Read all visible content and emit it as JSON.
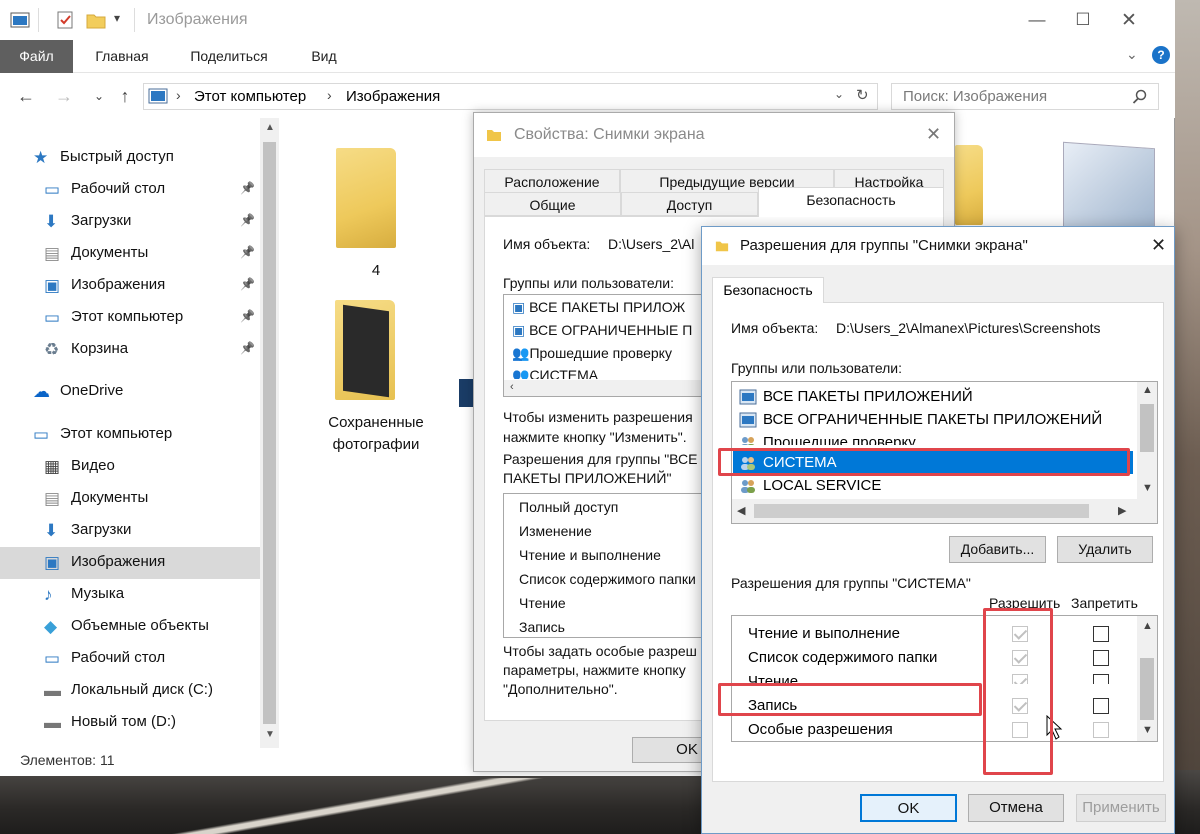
{
  "window": {
    "title": "Изображения",
    "minimize": "—",
    "maximize": "☐",
    "close": "✕"
  },
  "ribbon": {
    "tabs": [
      "Файл",
      "Главная",
      "Поделиться",
      "Вид"
    ],
    "help": "?"
  },
  "address": {
    "crumbs": [
      "Этот компьютер",
      "Изображения"
    ],
    "search_placeholder": "Поиск: Изображения"
  },
  "nav": {
    "items": [
      {
        "label": "Быстрый доступ",
        "icon": "star-icon",
        "pinned": false,
        "indent": 0
      },
      {
        "label": "Рабочий стол",
        "icon": "desktop-icon",
        "pinned": true,
        "indent": 1
      },
      {
        "label": "Загрузки",
        "icon": "download-icon",
        "pinned": true,
        "indent": 1
      },
      {
        "label": "Документы",
        "icon": "document-icon",
        "pinned": true,
        "indent": 1
      },
      {
        "label": "Изображения",
        "icon": "pictures-icon",
        "pinned": true,
        "indent": 1
      },
      {
        "label": "Этот компьютер",
        "icon": "computer-icon",
        "pinned": true,
        "indent": 1
      },
      {
        "label": "Корзина",
        "icon": "recycle-bin-icon",
        "pinned": true,
        "indent": 1
      },
      {
        "label": "OneDrive",
        "icon": "onedrive-icon",
        "pinned": false,
        "indent": 0
      },
      {
        "label": "Этот компьютер",
        "icon": "computer-icon",
        "pinned": false,
        "indent": 0
      },
      {
        "label": "Видео",
        "icon": "video-icon",
        "pinned": false,
        "indent": 1
      },
      {
        "label": "Документы",
        "icon": "document-icon",
        "pinned": false,
        "indent": 1
      },
      {
        "label": "Загрузки",
        "icon": "download-icon",
        "pinned": false,
        "indent": 1
      },
      {
        "label": "Изображения",
        "icon": "pictures-icon",
        "pinned": false,
        "indent": 1,
        "selected": true
      },
      {
        "label": "Музыка",
        "icon": "music-icon",
        "pinned": false,
        "indent": 1
      },
      {
        "label": "Объемные объекты",
        "icon": "3d-objects-icon",
        "pinned": false,
        "indent": 1
      },
      {
        "label": "Рабочий стол",
        "icon": "desktop-icon",
        "pinned": false,
        "indent": 1
      },
      {
        "label": "Локальный диск (C:)",
        "icon": "drive-icon",
        "pinned": false,
        "indent": 1
      },
      {
        "label": "Новый том (D:)",
        "icon": "drive-icon",
        "pinned": false,
        "indent": 1
      }
    ]
  },
  "status": {
    "items_count": "Элементов: 11"
  },
  "content": {
    "folders": [
      {
        "label": "4"
      },
      {
        "label1": "Сохраненные",
        "label2": "фотографии"
      }
    ]
  },
  "props_dialog": {
    "title": "Свойства: Снимки экрана",
    "tabs_row1": [
      "Расположение",
      "Предыдущие версии",
      "Настройка"
    ],
    "tabs_row2": [
      "Общие",
      "Доступ",
      "Безопасность"
    ],
    "object_label": "Имя объекта:",
    "object_value": "D:\\Users_2\\Al",
    "groups_label": "Группы или пользователи:",
    "groups": [
      "ВСЕ ПАКЕТЫ ПРИЛОЖ",
      "ВСЕ ОГРАНИЧЕННЫЕ П",
      "Прошедшие проверку",
      "СИСТЕМА"
    ],
    "change_hint1": "Чтобы изменить разрешения",
    "change_hint2": "нажмите кнопку \"Изменить\".",
    "perm_for1": "Разрешения для группы \"ВСЕ",
    "perm_for2": "ПАКЕТЫ ПРИЛОЖЕНИЙ\"",
    "perms": [
      "Полный доступ",
      "Изменение",
      "Чтение и выполнение",
      "Список содержимого папки",
      "Чтение",
      "Запись"
    ],
    "special_hint1": "Чтобы задать особые разреш",
    "special_hint2": "параметры, нажмите кнопку",
    "special_hint3": "\"Дополнительно\".",
    "ok": "OK"
  },
  "perm_dialog": {
    "title": "Разрешения для группы \"Снимки экрана\"",
    "tab": "Безопасность",
    "object_label": "Имя объекта:",
    "object_value": "D:\\Users_2\\Almanex\\Pictures\\Screenshots",
    "groups_label": "Группы или пользователи:",
    "groups": [
      {
        "label": "ВСЕ ПАКЕТЫ ПРИЛОЖЕНИЙ",
        "icon": "app-package-icon"
      },
      {
        "label": "ВСЕ ОГРАНИЧЕННЫЕ ПАКЕТЫ ПРИЛОЖЕНИЙ",
        "icon": "app-package-icon"
      },
      {
        "label": "Прошедшие проверку",
        "icon": "users-icon"
      },
      {
        "label": "СИСТЕМА",
        "icon": "users-icon",
        "selected": true
      },
      {
        "label": "LOCAL SERVICE",
        "icon": "users-icon"
      }
    ],
    "add": "Добавить...",
    "remove": "Удалить",
    "perm_for": "Разрешения для группы \"СИСТЕМА\"",
    "allow": "Разрешить",
    "deny": "Запретить",
    "perms": [
      {
        "label": "Чтение и выполнение",
        "allow": true,
        "deny": false
      },
      {
        "label": "Список содержимого папки",
        "allow": true,
        "deny": false
      },
      {
        "label": "Чтение",
        "allow": true,
        "deny": false
      },
      {
        "label": "Запись",
        "allow": true,
        "deny": false
      },
      {
        "label": "Особые разрешения",
        "allow": false,
        "deny": false
      }
    ],
    "ok": "OK",
    "cancel": "Отмена",
    "apply": "Применить",
    "highlight_color": "#e0454b",
    "selection_color": "#0078d7"
  }
}
